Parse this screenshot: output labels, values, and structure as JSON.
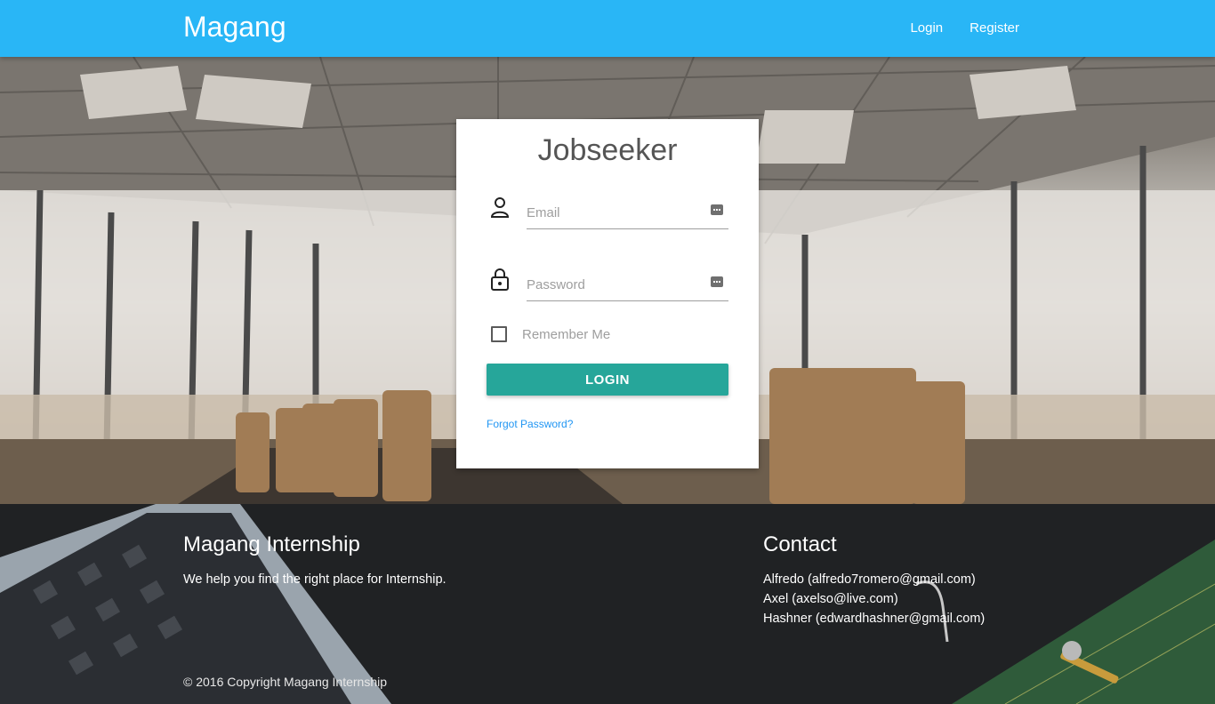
{
  "navbar": {
    "brand": "Magang",
    "links": [
      "Login",
      "Register"
    ]
  },
  "login_form": {
    "title": "Jobseeker",
    "email_placeholder": "Email",
    "password_placeholder": "Password",
    "remember_label": "Remember Me",
    "submit_label": "Login",
    "forgot_label": "Forgot Password?"
  },
  "footer": {
    "about": {
      "title": "Magang Internship",
      "text": "We help you find the right place for Internship."
    },
    "contact": {
      "title": "Contact",
      "people": [
        "Alfredo (alfredo7romero@gmail.com)",
        "Axel (axelso@live.com)",
        "Hashner (edwardhashner@gmail.com)"
      ]
    },
    "copyright": "© 2016 Copyright Magang Internship"
  },
  "colors": {
    "navbar": "#29b6f6",
    "button": "#26a69a",
    "link": "#2196f3",
    "footer": "#202224"
  }
}
